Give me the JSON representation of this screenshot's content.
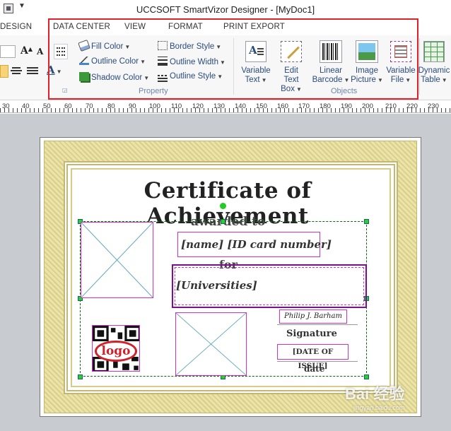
{
  "window": {
    "title": "UCCSOFT SmartVizor Designer - [MyDoc1]"
  },
  "tabs": [
    "DESIGN",
    "DATA CENTER",
    "VIEW",
    "FORMAT",
    "PRINT EXPORT"
  ],
  "ribbon": {
    "property": {
      "label": "Property",
      "fill_color": "Fill Color",
      "outline_color": "Outline Color",
      "shadow_color": "Shadow Color",
      "border_style": "Border Style",
      "outline_width": "Outline Width",
      "outline_style": "Outline Style"
    },
    "objects": {
      "label": "Objects",
      "variable_text": [
        "Variable",
        "Text"
      ],
      "edit_text_box": [
        "Edit",
        "Text Box"
      ],
      "linear_barcode": [
        "Linear",
        "Barcode"
      ],
      "image_picture": [
        "Image",
        "Picture"
      ],
      "variable_file": [
        "Variable",
        "File"
      ]
    },
    "dynamic_table": [
      "Dynamic",
      "Table"
    ],
    "font_buttons": {
      "grow": "A",
      "shrink": "A",
      "color": "A"
    }
  },
  "ruler": [
    "30",
    "40",
    "50",
    "60",
    "70",
    "80",
    "90",
    "100",
    "110",
    "120",
    "130",
    "140",
    "150",
    "160",
    "170",
    "180",
    "190",
    "200",
    "210",
    "220",
    "230"
  ],
  "document": {
    "title": "Certificate of Achievement",
    "awarded_to": "awarded to",
    "name_field": "[name]  [ID card number]",
    "for_label": "for",
    "universities_field": "[Universities]",
    "signature_image": "Philip J. Barham",
    "signature_label": "Signature",
    "date_field": "[DATE OF ISSUE]",
    "date_label": "date",
    "logo": "logo"
  },
  "watermark": {
    "text": "Bai 经验",
    "sub": "jingyan.baidu.com"
  },
  "colors": {
    "highlight": "#e0202a",
    "selection": "#d030d0",
    "accent": "#2a4b7c"
  }
}
